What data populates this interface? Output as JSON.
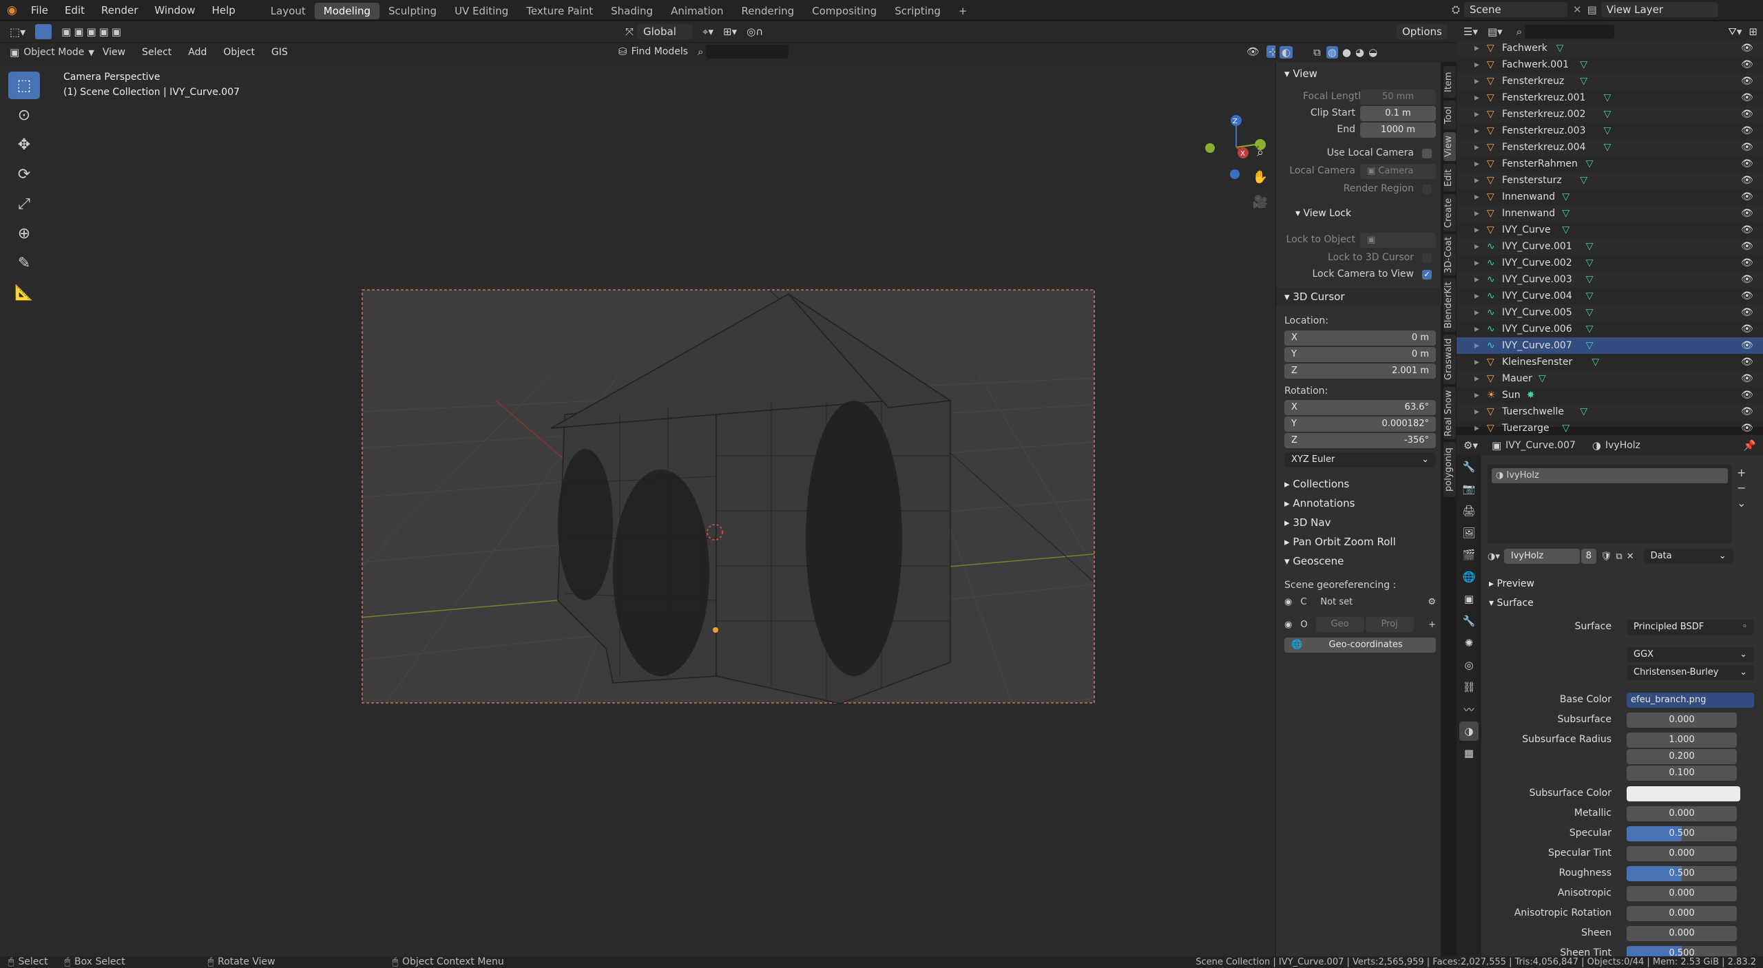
{
  "topbar": {
    "menus": [
      "File",
      "Edit",
      "Render",
      "Window",
      "Help"
    ],
    "workspaces": [
      "Layout",
      "Modeling",
      "Sculpting",
      "UV Editing",
      "Texture Paint",
      "Shading",
      "Animation",
      "Rendering",
      "Compositing",
      "Scripting"
    ],
    "add_tab": "+",
    "scene": "Scene",
    "view_layer": "View Layer"
  },
  "header": {
    "transform": "Global",
    "options": "Options",
    "mode": "Object Mode",
    "menus": [
      "View",
      "Select",
      "Add",
      "Object",
      "GIS"
    ],
    "find_models": "Find Models"
  },
  "viewport": {
    "title": "Camera Perspective",
    "subtitle": "(1) Scene Collection | IVY_Curve.007"
  },
  "vtabs": [
    "Item",
    "Tool",
    "View",
    "Edit",
    "Create",
    "3D-Coat",
    "BlenderKit",
    "Graswald",
    "Real Snow",
    "polygoniq"
  ],
  "npanel": {
    "view_header": "View",
    "focal_label": "Focal Length",
    "focal": "50 mm",
    "clip_start_label": "Clip Start",
    "clip_start": "0.1 m",
    "end_label": "End",
    "end": "1000 m",
    "use_local_camera": "Use Local Camera",
    "local_camera": "Local Camera",
    "camera": "Camera",
    "render_region": "Render Region",
    "view_lock": "View Lock",
    "lock_to_object": "Lock to Object",
    "lock_to_cursor": "Lock to 3D Cursor",
    "lock_camera": "Lock Camera to View",
    "cursor_header": "3D Cursor",
    "location": "Location:",
    "loc_x": "0 m",
    "loc_y": "0 m",
    "loc_z": "2.001 m",
    "rotation": "Rotation:",
    "rot_x": "63.6°",
    "rot_y": "0.000182°",
    "rot_z": "-356°",
    "rot_mode": "XYZ Euler",
    "collections": "Collections",
    "annotations": "Annotations",
    "nav3d": "3D Nav",
    "pan_orbit": "Pan Orbit Zoom Roll",
    "geoscene": "Geoscene",
    "georef": "Scene georeferencing :",
    "c": "C",
    "not_set": "Not set",
    "o": "O",
    "geo": "Geo",
    "proj": "Proj",
    "geo_coords": "Geo-coordinates",
    "axis_x": "X",
    "axis_y": "Y",
    "axis_z": "Z"
  },
  "outliner": {
    "items": [
      {
        "name": "Fachwerk",
        "type": "mesh"
      },
      {
        "name": "Fachwerk.001",
        "type": "mesh"
      },
      {
        "name": "Fensterkreuz",
        "type": "mesh"
      },
      {
        "name": "Fensterkreuz.001",
        "type": "mesh"
      },
      {
        "name": "Fensterkreuz.002",
        "type": "mesh"
      },
      {
        "name": "Fensterkreuz.003",
        "type": "mesh"
      },
      {
        "name": "Fensterkreuz.004",
        "type": "mesh"
      },
      {
        "name": "FensterRahmen",
        "type": "mesh"
      },
      {
        "name": "Fenstersturz",
        "type": "mesh"
      },
      {
        "name": "Innenwand",
        "type": "mesh"
      },
      {
        "name": "Innenwand",
        "type": "mesh"
      },
      {
        "name": "IVY_Curve",
        "type": "mesh"
      },
      {
        "name": "IVY_Curve.001",
        "type": "curve"
      },
      {
        "name": "IVY_Curve.002",
        "type": "curve"
      },
      {
        "name": "IVY_Curve.003",
        "type": "curve"
      },
      {
        "name": "IVY_Curve.004",
        "type": "curve"
      },
      {
        "name": "IVY_Curve.005",
        "type": "curve"
      },
      {
        "name": "IVY_Curve.006",
        "type": "curve"
      },
      {
        "name": "IVY_Curve.007",
        "type": "curve"
      },
      {
        "name": "KleinesFenster",
        "type": "mesh"
      },
      {
        "name": "Mauer",
        "type": "mesh"
      },
      {
        "name": "Sun",
        "type": "light"
      },
      {
        "name": "Tuerschwelle",
        "type": "mesh"
      },
      {
        "name": "Tuerzarge",
        "type": "mesh"
      }
    ]
  },
  "props": {
    "object": "IVY_Curve.007",
    "material": "IvyHolz",
    "slot": "IvyHolz",
    "mat_field": "IvyHolz",
    "users": "8",
    "data": "Data",
    "preview": "Preview",
    "surface_header": "Surface",
    "surface_label": "Surface",
    "surface": "Principled BSDF",
    "ggx": "GGX",
    "subsurface_method": "Christensen-Burley",
    "rows": [
      {
        "label": "Base Color",
        "value": "efeu_branch.png"
      },
      {
        "label": "Subsurface",
        "value": "0.000"
      },
      {
        "label": "Subsurface Radius",
        "value": "1.000"
      },
      {
        "label": "",
        "value": "0.200"
      },
      {
        "label": "",
        "value": "0.100"
      },
      {
        "label": "Subsurface Color",
        "value": ""
      },
      {
        "label": "Metallic",
        "value": "0.000"
      },
      {
        "label": "Specular",
        "value": "0.500"
      },
      {
        "label": "Specular Tint",
        "value": "0.000"
      },
      {
        "label": "Roughness",
        "value": "0.500"
      },
      {
        "label": "Anisotropic",
        "value": "0.000"
      },
      {
        "label": "Anisotropic Rotation",
        "value": "0.000"
      },
      {
        "label": "Sheen",
        "value": "0.000"
      },
      {
        "label": "Sheen Tint",
        "value": "0.500"
      }
    ]
  },
  "status": {
    "select": "Select",
    "box_select": "Box Select",
    "rotate": "Rotate View",
    "context": "Object Context Menu",
    "stats": "Scene Collection | IVY_Curve.007 | Verts:2,565,959 | Faces:2,027,555 | Tris:4,056,847 | Objects:0/44 | Mem: 2.53 GiB | 2.83.2"
  },
  "colors": {
    "accent": "#4772b3",
    "mesh": "#ff9f3c",
    "curve": "#3fd3a0"
  }
}
